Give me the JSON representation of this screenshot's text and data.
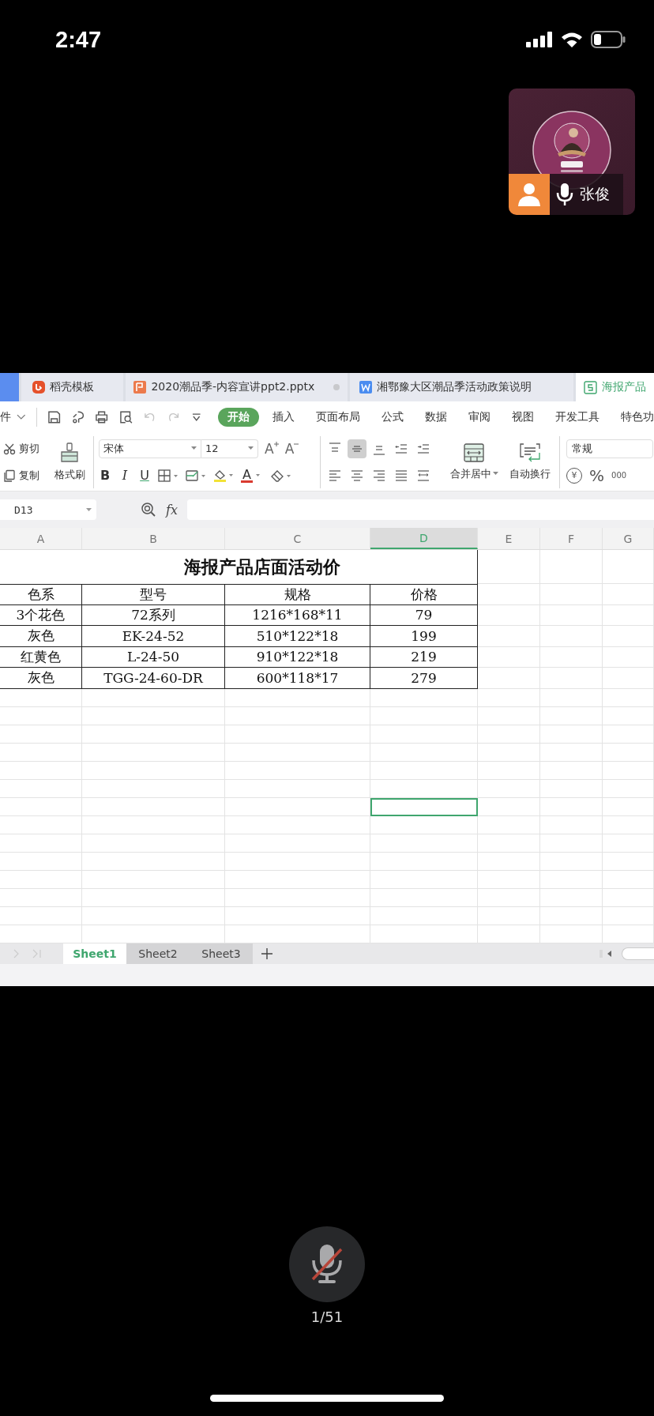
{
  "status_bar": {
    "time": "2:47"
  },
  "participant": {
    "name": "张俊",
    "kind": "picture"
  },
  "shared_screen": {
    "doc_tabs": [
      {
        "label": "稻壳模板",
        "kind": "daoke",
        "selected": false
      },
      {
        "label": "2020潮品季-内容宣讲ppt2.pptx",
        "kind": "ppt",
        "selected": false
      },
      {
        "label": "湘鄂豫大区潮品季活动政策说明",
        "kind": "word",
        "selected": false
      },
      {
        "label": "海报产品",
        "kind": "sheet",
        "selected": true
      }
    ],
    "menu": {
      "file_label": "件",
      "tabs": [
        {
          "label": "开始",
          "selected": true
        },
        {
          "label": "插入",
          "selected": false
        },
        {
          "label": "页面布局",
          "selected": false
        },
        {
          "label": "公式",
          "selected": false
        },
        {
          "label": "数据",
          "selected": false
        },
        {
          "label": "审阅",
          "selected": false
        },
        {
          "label": "视图",
          "selected": false
        },
        {
          "label": "开发工具",
          "selected": false
        },
        {
          "label": "特色功",
          "selected": false
        }
      ]
    },
    "ribbon": {
      "cut": "剪切",
      "copy": "复制",
      "format_painter": "格式刷",
      "font": "宋体",
      "font_size": "12",
      "font_size_buttons": [
        {
          "kind": "grow",
          "glyph": "A"
        },
        {
          "kind": "shrink",
          "glyph": "A"
        }
      ],
      "format_buttons": [
        {
          "kind": "bold",
          "glyph": "B"
        },
        {
          "kind": "italic",
          "glyph": "I"
        },
        {
          "kind": "underline",
          "glyph": "U"
        }
      ],
      "font_color_glyph": "A",
      "align_top": [
        {
          "kind": "top",
          "selected": false
        },
        {
          "kind": "middle",
          "selected": true
        },
        {
          "kind": "bottom",
          "selected": false
        },
        {
          "kind": "indent-decrease",
          "selected": false
        },
        {
          "kind": "indent-increase",
          "selected": false
        }
      ],
      "align_bottom": [
        {
          "kind": "left",
          "selected": false
        },
        {
          "kind": "center",
          "selected": false
        },
        {
          "kind": "right",
          "selected": false
        },
        {
          "kind": "justify",
          "selected": false
        },
        {
          "kind": "distribute",
          "selected": false
        }
      ],
      "merge": "合并居中",
      "wrap": "自动换行",
      "number_format": "常规",
      "number_buttons": [
        {
          "kind": "currency",
          "glyph": "¥"
        },
        {
          "kind": "percent",
          "glyph": "%"
        },
        {
          "kind": "thousands",
          "glyph": "000"
        }
      ]
    },
    "formula_bar": {
      "name_box": "D13",
      "fx": "fx"
    },
    "sheet": {
      "columns": [
        {
          "label": "A",
          "selected": false
        },
        {
          "label": "B",
          "selected": false
        },
        {
          "label": "C",
          "selected": false
        },
        {
          "label": "D",
          "selected": true
        },
        {
          "label": "E",
          "selected": false
        },
        {
          "label": "F",
          "selected": false
        },
        {
          "label": "G",
          "selected": false
        }
      ],
      "title": "海报产品店面活动价",
      "header": [
        "色系",
        "型号",
        "规格",
        "价格"
      ],
      "rows": [
        [
          "3个花色",
          "72系列",
          "1216*168*11",
          "79"
        ],
        [
          "灰色",
          "EK-24-52",
          "510*122*18",
          "199"
        ],
        [
          "红黄色",
          "L-24-50",
          "910*122*18",
          "219"
        ],
        [
          "灰色",
          "TGG-24-60-DR",
          "600*118*17",
          "279"
        ]
      ],
      "empty_rows": [
        {
          "selected": false
        },
        {
          "selected": false
        },
        {
          "selected": false
        },
        {
          "selected": false
        },
        {
          "selected": false
        },
        {
          "selected": false
        },
        {
          "selected": true
        },
        {
          "selected": false
        },
        {
          "selected": false
        },
        {
          "selected": false
        },
        {
          "selected": false
        },
        {
          "selected": false
        },
        {
          "selected": false
        },
        {
          "selected": false
        }
      ]
    },
    "sheet_tabs": [
      {
        "label": "Sheet1",
        "selected": true
      },
      {
        "label": "Sheet2",
        "selected": false
      },
      {
        "label": "Sheet3",
        "selected": false
      }
    ]
  },
  "mic": {
    "muted": true
  },
  "page_counter": "1/51"
}
